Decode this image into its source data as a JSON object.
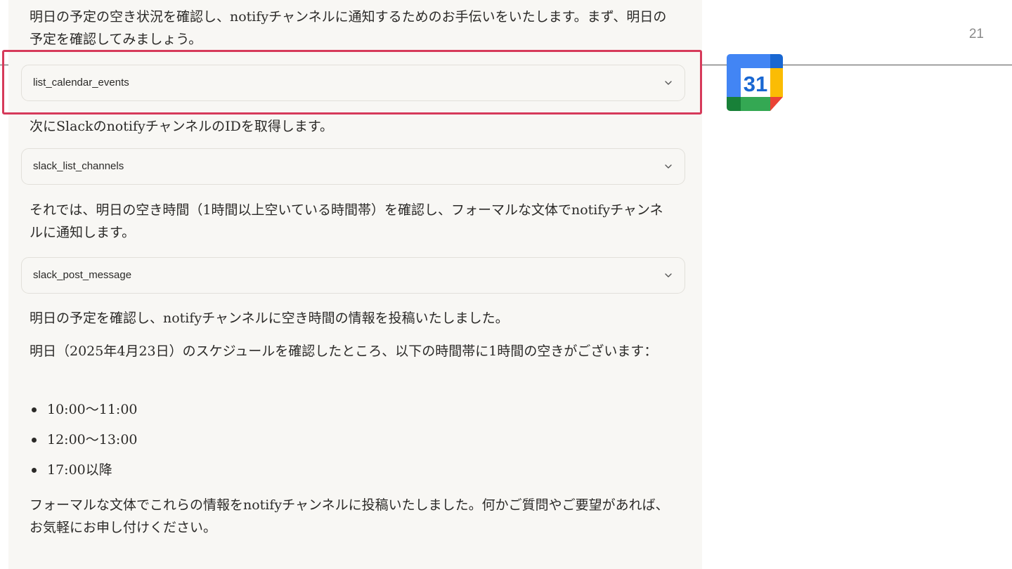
{
  "page_number": "21",
  "chat": {
    "intro": "明日の予定の空き状況を確認し、notifyチャンネルに通知するためのお手伝いをいたします。まず、明日の予定を確認してみましょう。",
    "tool1": "list_calendar_events",
    "msg2": "次にSlackのnotifyチャンネルのIDを取得します。",
    "tool2": "slack_list_channels",
    "msg3": "それでは、明日の空き時間（1時間以上空いている時間帯）を確認し、フォーマルな文体でnotifyチャンネルに通知します。",
    "tool3": "slack_post_message",
    "msg4": "明日の予定を確認し、notifyチャンネルに空き時間の情報を投稿いたしました。",
    "msg5": "明日（2025年4月23日）のスケジュールを確認したところ、以下の時間帯に1時間の空きがございます：",
    "slots": [
      "10:00〜11:00",
      "12:00〜13:00",
      "17:00以降"
    ],
    "msg6": "フォーマルな文体でこれらの情報をnotifyチャンネルに投稿いたしました。何かご質問やご要望があれば、お気軽にお申し付けください。"
  },
  "calendar_icon": {
    "name": "google-calendar-icon",
    "day": "31",
    "colors": {
      "blue": "#4285f4",
      "dark_blue": "#1967d2",
      "green": "#34a853",
      "dark_green": "#188038",
      "yellow": "#fbbc04",
      "red": "#ea4335"
    }
  },
  "highlight_color": "#d63a5a"
}
